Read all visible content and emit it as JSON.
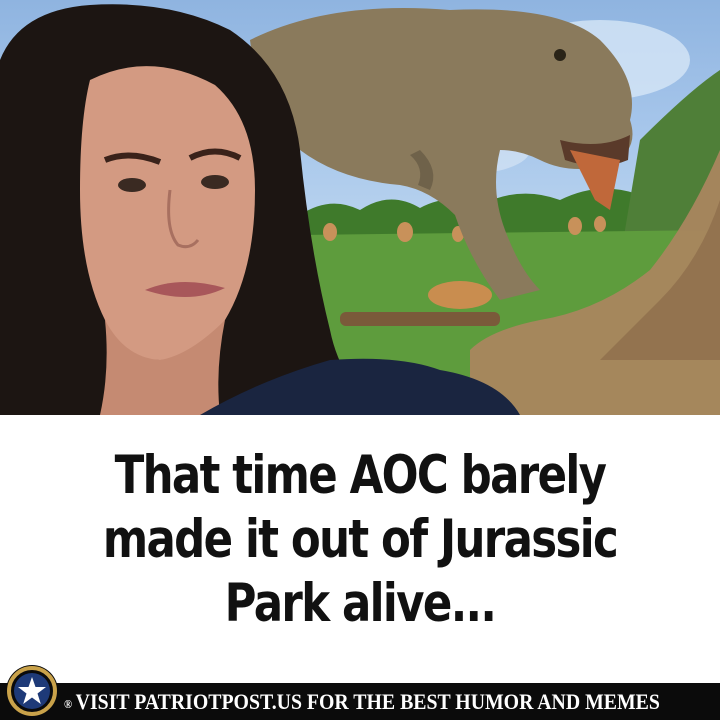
{
  "meme": {
    "caption": "That time AOC barely made it out of Jurassic Park alive...",
    "footer_text": "VISIT PATRIOTPOST.US FOR THE BEST HUMOR AND MEMES",
    "registered_mark": "®"
  },
  "photo": {
    "left_subject": "woman-crying-portrait",
    "right_subject": "t-rex-eating-dinosaur"
  },
  "logo": {
    "icon": "star-icon",
    "ring_color": "#c9a24a",
    "badge_color": "#1e3a78"
  },
  "colors": {
    "background": "#ffffff",
    "caption_text": "#111111",
    "footer_bg": "#0b0b0b",
    "footer_text": "#ffffff"
  }
}
